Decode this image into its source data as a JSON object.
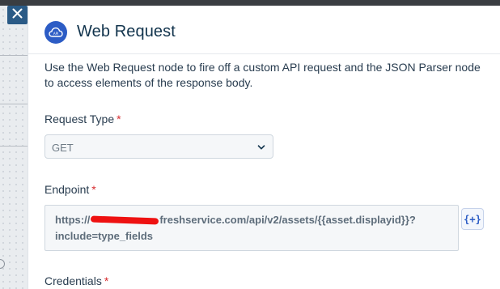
{
  "header": {
    "title": "Web Request",
    "icon": "cloud-api-icon"
  },
  "description": "Use the Web Request node to fire off a custom API request and the JSON Parser node to access elements of the response body.",
  "request_type": {
    "label": "Request Type",
    "required_marker": "*",
    "value": "GET"
  },
  "endpoint": {
    "label": "Endpoint",
    "required_marker": "*",
    "value_prefix": "https://",
    "value_suffix": "freshservice.com/api/v2/assets/{{asset.displayid}}?",
    "value_line2": "include=type_fields",
    "insert_placeholder_label": "{+}"
  },
  "credentials": {
    "label": "Credentials",
    "required_marker": "*"
  },
  "colors": {
    "accent": "#2c5cc5",
    "close_button": "#2a5a86",
    "required": "#d72d30",
    "redaction": "#ee1111"
  }
}
